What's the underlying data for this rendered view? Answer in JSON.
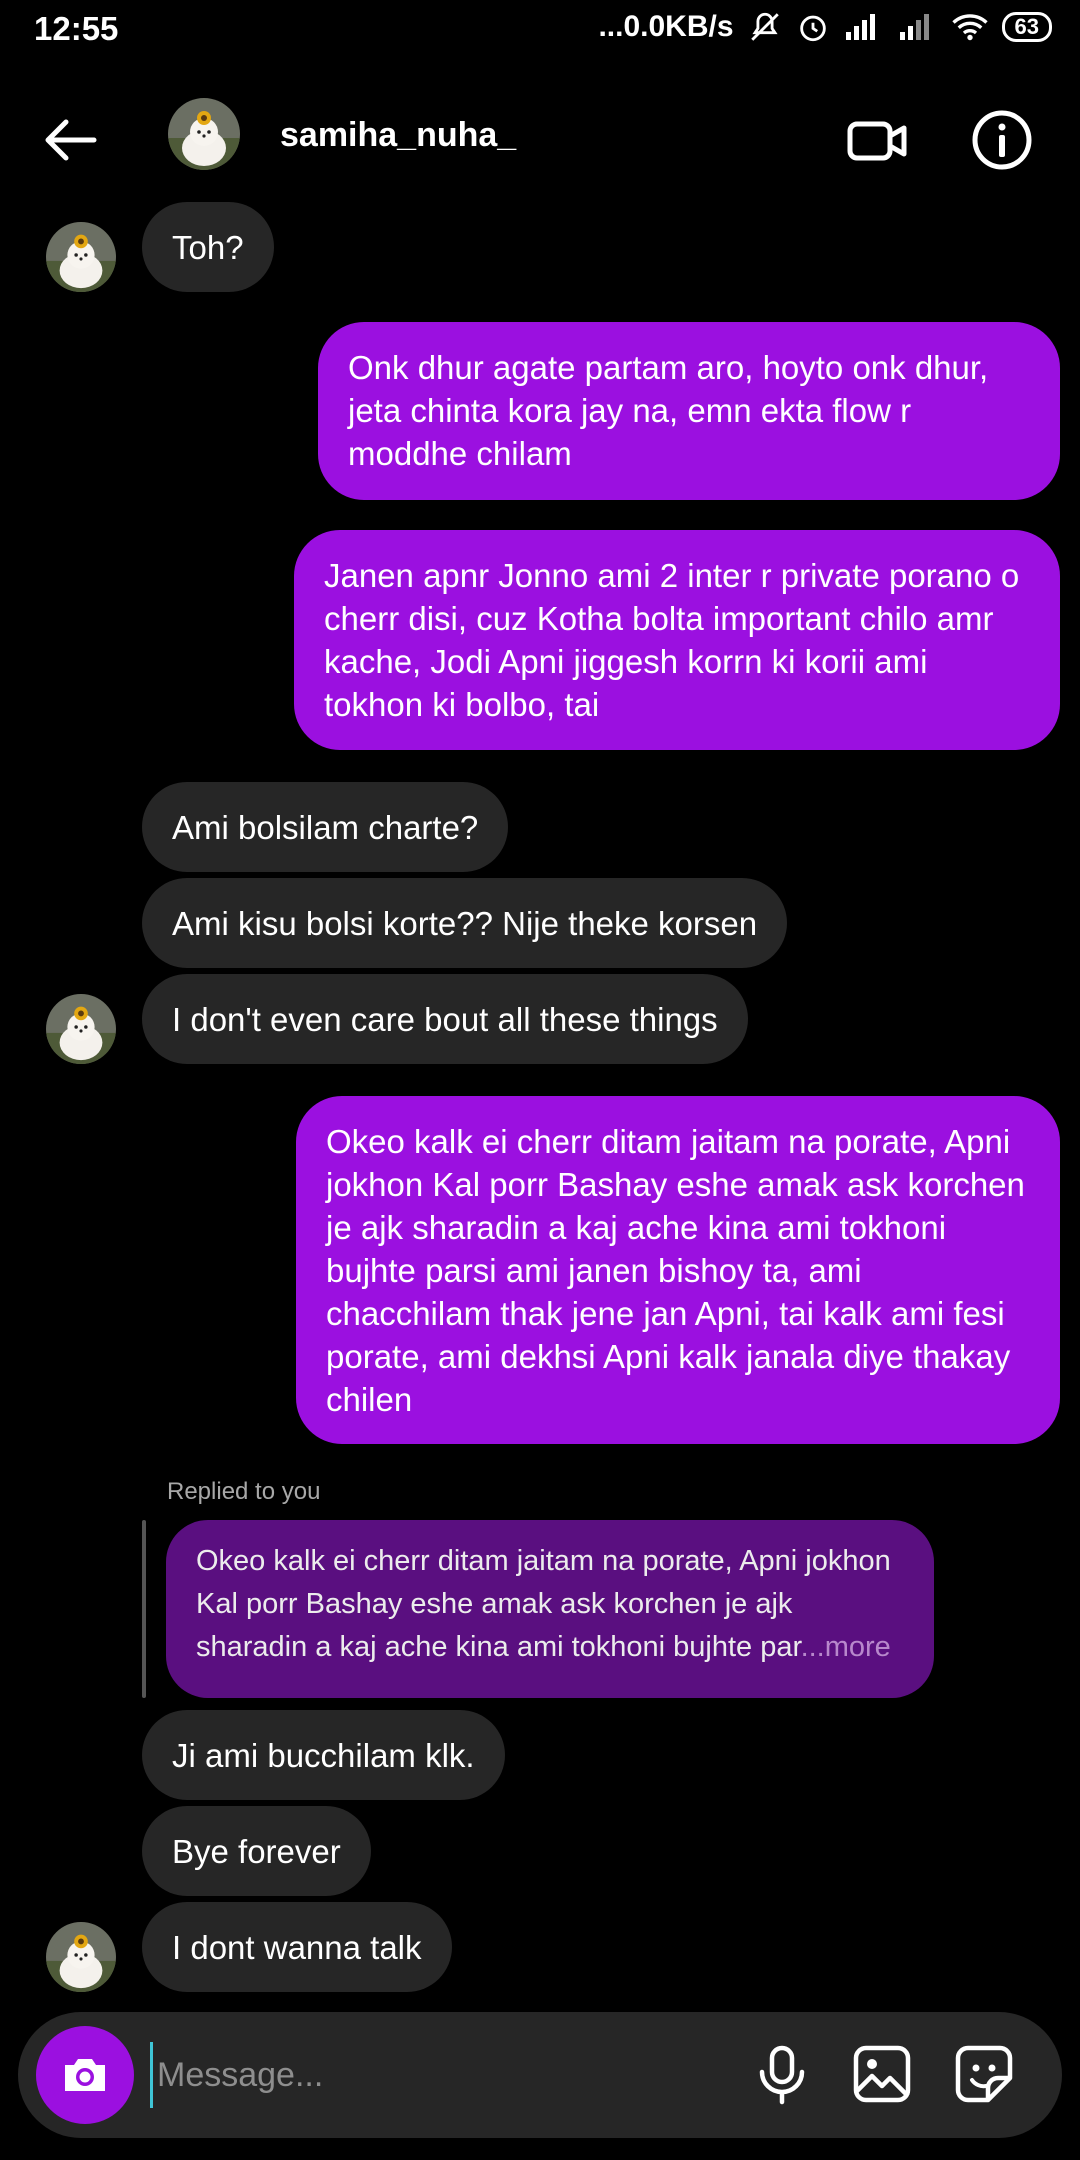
{
  "status_bar": {
    "time": "12:55",
    "network_speed": "0.0KB/s",
    "battery": "63"
  },
  "header": {
    "username": "samiha_nuha_"
  },
  "messages": [
    {
      "from": "them",
      "text": "Toh?"
    },
    {
      "from": "me",
      "text": "Onk dhur agate partam aro, hoyto onk dhur, jeta chinta kora jay na, emn ekta flow r moddhe chilam"
    },
    {
      "from": "me",
      "text": "Janen apnr Jonno ami 2 inter r private porano o cherr disi, cuz Kotha bolta important chilo amr kache, Jodi Apni jiggesh korrn ki korii ami tokhon ki bolbo, tai"
    },
    {
      "from": "them",
      "text": "Ami bolsilam charte?"
    },
    {
      "from": "them",
      "text": "Ami kisu bolsi korte?? Nije theke korsen"
    },
    {
      "from": "them",
      "text": "I don't even care bout all these things"
    },
    {
      "from": "me",
      "text": "Okeo kalk ei  cherr ditam jaitam na porate, Apni jokhon Kal porr Bashay eshe amak ask korchen je ajk sharadin a kaj ache kina ami tokhoni bujhte parsi ami janen bishoy ta, ami chacchilam thak jene jan Apni, tai kalk ami fesi porate, ami dekhsi Apni kalk janala diye thakay chilen"
    },
    {
      "from": "them",
      "text": "Ji ami bucchilam klk."
    },
    {
      "from": "them",
      "text": "Bye forever"
    },
    {
      "from": "them",
      "text": "I dont wanna talk"
    }
  ],
  "reply": {
    "label": "Replied to you",
    "quote": "Okeo kalk ei  cherr ditam jaitam na porate, Apni jokhon Kal porr Bashay eshe amak ask korchen je ajk sharadin a kaj ache kina ami tokhoni bujhte par",
    "more": "...more"
  },
  "composer": {
    "placeholder": "Message..."
  },
  "colors": {
    "background": "#000000",
    "outgoing_bubble": "#9b10e0",
    "incoming_bubble": "#262626",
    "quote_bubble": "#5a0f80"
  },
  "icons": [
    "back-arrow-icon",
    "video-call-icon",
    "info-icon",
    "camera-icon",
    "microphone-icon",
    "gallery-icon",
    "sticker-icon"
  ]
}
